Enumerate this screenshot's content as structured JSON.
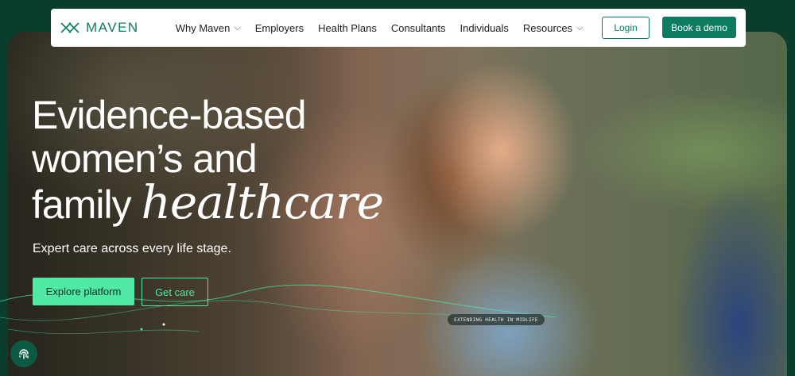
{
  "nav": {
    "logo_text": "MAVEN",
    "items": [
      {
        "label": "Why Maven",
        "has_dropdown": true
      },
      {
        "label": "Employers",
        "has_dropdown": false
      },
      {
        "label": "Health Plans",
        "has_dropdown": false
      },
      {
        "label": "Consultants",
        "has_dropdown": false
      },
      {
        "label": "Individuals",
        "has_dropdown": false
      },
      {
        "label": "Resources",
        "has_dropdown": true
      }
    ],
    "login_label": "Login",
    "demo_label": "Book a demo"
  },
  "hero": {
    "line1": "Evidence-based",
    "line2": "women’s and",
    "line3": "family",
    "accent": "healthcare",
    "subtitle": "Expert care across every life stage.",
    "primary_cta": "Explore platform",
    "secondary_cta": "Get care",
    "tag": "EXTENDING HEALTH IN MIDLIFE"
  },
  "icons": {
    "dropdown": "chevron-down-icon",
    "logo": "maven-logo-icon",
    "fingerprint": "fingerprint-icon"
  },
  "colors": {
    "brand": "#0d7b60",
    "accent": "#4fe8a4",
    "background": "#0b3d2c"
  }
}
